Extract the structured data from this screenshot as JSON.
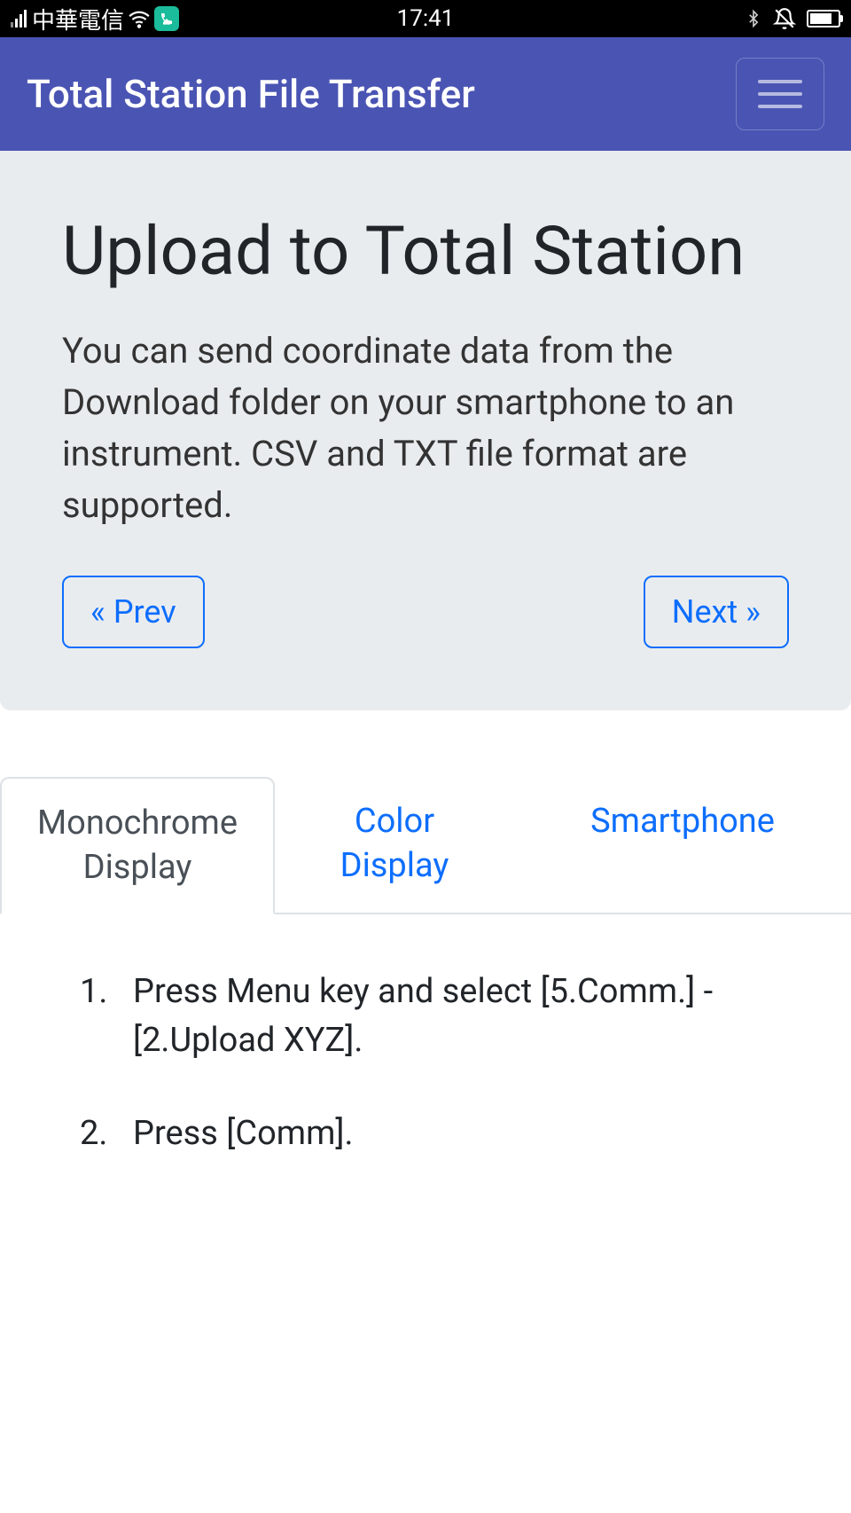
{
  "status_bar": {
    "carrier": "中華電信",
    "time": "17:41"
  },
  "navbar": {
    "title": "Total Station File Transfer"
  },
  "hero": {
    "heading": "Upload to Total Station",
    "description": "You can send coordinate data from the Download folder on your smartphone to an instrument. CSV and TXT file format are supported.",
    "prev_label": "« Prev",
    "next_label": "Next »"
  },
  "tabs": [
    {
      "label": "Monochrome Display",
      "active": true
    },
    {
      "label": "Color Display",
      "active": false
    },
    {
      "label": "Smartphone",
      "active": false
    }
  ],
  "instructions": [
    "Press Menu key and select [5.Comm.] - [2.Upload XYZ].",
    "Press [Comm]."
  ]
}
